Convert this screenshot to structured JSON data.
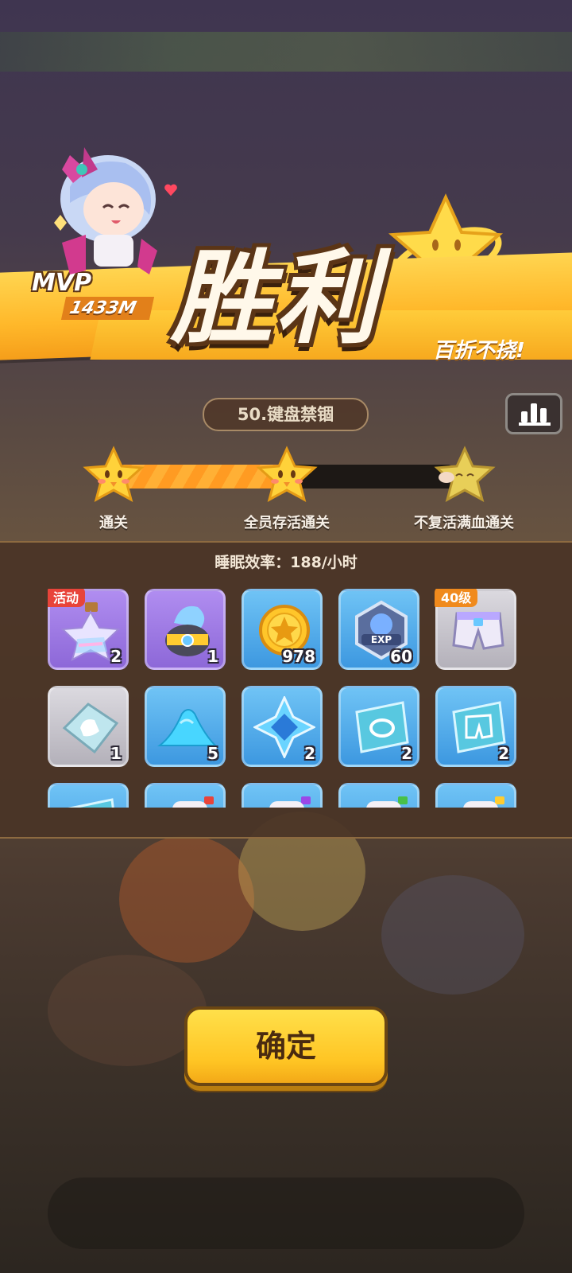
{
  "victory": {
    "title": "胜利",
    "tagline": "百折不挠!",
    "mvp_label": "MVP",
    "mvp_score": "1433M"
  },
  "stage": {
    "name": "50.键盘禁锢"
  },
  "progress": {
    "fill_fraction": 0.5,
    "milestones": [
      {
        "label": "通关",
        "achieved": true
      },
      {
        "label": "全员存活通关",
        "achieved": true
      },
      {
        "label": "不复活满血通关",
        "achieved": false
      }
    ]
  },
  "rewards": {
    "efficiency": "睡眠效率：188/小时",
    "items": [
      {
        "icon": "star-potion-icon",
        "count": "2",
        "tag": "活动",
        "rarity": "purple"
      },
      {
        "icon": "spirit-orb-icon",
        "count": "1",
        "tag": "",
        "rarity": "purple"
      },
      {
        "icon": "gold-coin-icon",
        "count": "978",
        "tag": "",
        "rarity": "blue"
      },
      {
        "icon": "exp-badge-icon",
        "count": "60",
        "tag": "",
        "rarity": "blue"
      },
      {
        "icon": "shorts-gear-icon",
        "count": "",
        "tag": "40级",
        "rarity": "gray"
      },
      {
        "icon": "glove-shard-icon",
        "count": "1",
        "tag": "",
        "rarity": "gray"
      },
      {
        "icon": "blue-powder-icon",
        "count": "5",
        "tag": "",
        "rarity": "blue"
      },
      {
        "icon": "blue-crystal-icon",
        "count": "2",
        "tag": "",
        "rarity": "blue"
      },
      {
        "icon": "ring-blueprint-icon",
        "count": "2",
        "tag": "",
        "rarity": "blue"
      },
      {
        "icon": "shorts-blueprint-icon",
        "count": "2",
        "tag": "",
        "rarity": "blue"
      },
      {
        "icon": "blueprint-icon",
        "count": "",
        "tag": "",
        "rarity": "blue"
      },
      {
        "icon": "red-potion-icon",
        "count": "",
        "tag": "",
        "rarity": "blue"
      },
      {
        "icon": "purple-potion-icon",
        "count": "",
        "tag": "",
        "rarity": "blue"
      },
      {
        "icon": "green-potion-icon",
        "count": "",
        "tag": "",
        "rarity": "blue"
      },
      {
        "icon": "yellow-potion-icon",
        "count": "",
        "tag": "",
        "rarity": "blue"
      }
    ]
  },
  "confirm_label": "确定"
}
